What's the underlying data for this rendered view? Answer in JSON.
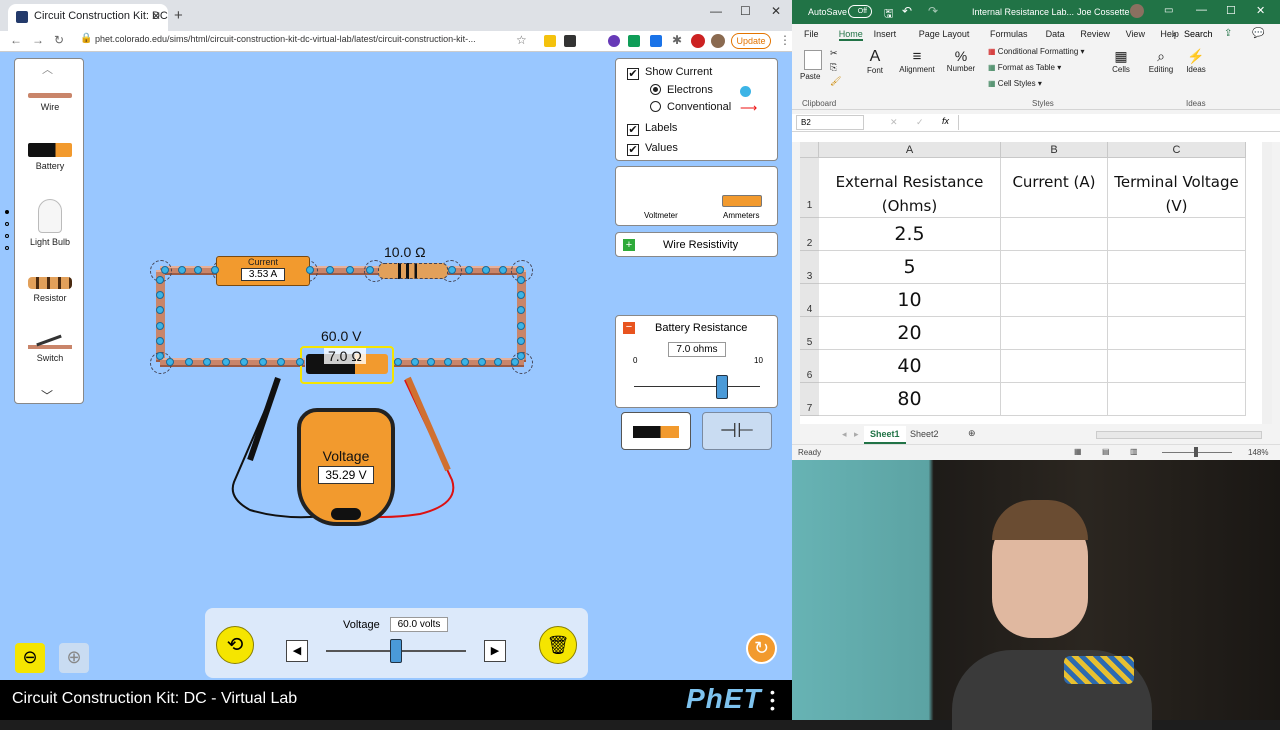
{
  "browser": {
    "tab_title": "Circuit Construction Kit: DC - Vir",
    "url": "phet.colorado.edu/sims/html/circuit-construction-kit-dc-virtual-lab/latest/circuit-construction-kit-...",
    "update_label": "Update"
  },
  "sim": {
    "title": "Circuit Construction Kit: DC - Virtual Lab",
    "logo": "PhET",
    "toolbox": [
      "Wire",
      "Battery",
      "Light Bulb",
      "Resistor",
      "Switch"
    ],
    "ammeter": {
      "label": "Current",
      "value": "3.53 A"
    },
    "resistor_label": "10.0 Ω",
    "battery_voltage_label": "60.0 V",
    "battery_resistance_label": "7.0 Ω",
    "voltmeter": {
      "label": "Voltage",
      "value": "35.29 V"
    },
    "show_current": {
      "label": "Show Current",
      "checked": true,
      "electrons": "Electrons",
      "conventional": "Conventional",
      "selected": "Electrons"
    },
    "labels_option": {
      "label": "Labels",
      "checked": true
    },
    "values_option": {
      "label": "Values",
      "checked": true
    },
    "sensors": {
      "voltmeter": "Voltmeter",
      "ammeters": "Ammeters"
    },
    "wire_resistivity": "Wire Resistivity",
    "battery_resistance": {
      "title": "Battery Resistance",
      "value": "7.0 ohms",
      "min": "0",
      "max": "10",
      "level": 0.7
    },
    "voltage_control": {
      "label": "Voltage",
      "value": "60.0 volts",
      "level": 0.5
    }
  },
  "excel": {
    "autosave": "AutoSave",
    "autosave_state": "Off",
    "file_title": "Internal Resistance Lab...",
    "user": "Joe Cossette",
    "search": "Search",
    "menus": [
      "File",
      "Home",
      "Insert",
      "Page Layout",
      "Formulas",
      "Data",
      "Review",
      "View",
      "Help"
    ],
    "active_menu": "Home",
    "ribbon": {
      "clipboard": "Clipboard",
      "paste": "Paste",
      "font": "Font",
      "alignment": "Alignment",
      "number": "Number",
      "conditional": "Conditional Formatting",
      "format_table": "Format as Table",
      "cell_styles": "Cell Styles",
      "styles": "Styles",
      "cells": "Cells",
      "editing": "Editing",
      "ideas": "Ideas",
      "ideas_group": "Ideas"
    },
    "name_box": "B2",
    "fx": "fx",
    "columns": [
      "A",
      "B",
      "C"
    ],
    "headers": [
      "External Resistance (Ohms)",
      "Current (A)",
      "Terminal Voltage (V)"
    ],
    "rows": [
      "2.5",
      "5",
      "10",
      "20",
      "40",
      "80"
    ],
    "row_numbers": [
      "1",
      "2",
      "3",
      "4",
      "5",
      "6",
      "7"
    ],
    "sheets": [
      "Sheet1",
      "Sheet2"
    ],
    "active_sheet": "Sheet1",
    "status": "Ready",
    "zoom": "148%"
  }
}
